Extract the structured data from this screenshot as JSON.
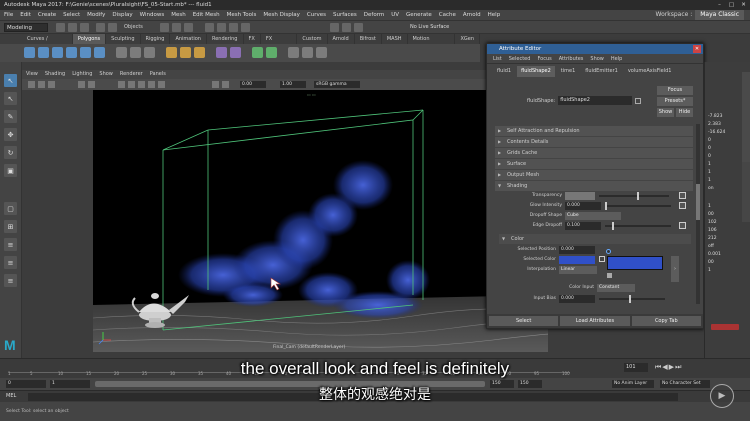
{
  "window": {
    "title": "Autodesk Maya 2017: F:\\Genie\\scenes\\Pluralsight\\FS_05-Start.mb* --- fluid1",
    "controls": [
      "–",
      "□",
      "✕"
    ]
  },
  "menubar": {
    "items": [
      "File",
      "Edit",
      "Create",
      "Select",
      "Modify",
      "Display",
      "Windows",
      "Mesh",
      "Edit Mesh",
      "Mesh Tools",
      "Mesh Display",
      "Curves",
      "Surfaces",
      "Deform",
      "UV",
      "Generate",
      "Cache",
      "Arnold",
      "Help"
    ],
    "workspace_label": "Workspace :",
    "workspace_value": "Maya Classic"
  },
  "statusline": {
    "mode": "Modeling",
    "objects_label": "Objects",
    "live_surface": "No Live Surface"
  },
  "shelf": {
    "tabs": [
      "Curves / Surfaces",
      "Polygons",
      "Sculpting",
      "Rigging",
      "Animation",
      "Rendering",
      "FX",
      "FX Caching",
      "Custom",
      "Arnold",
      "Bifrost",
      "MASH",
      "Motion Graphics",
      "XGen"
    ],
    "active_tab": "Polygons"
  },
  "panel": {
    "menu": [
      "View",
      "Shading",
      "Lighting",
      "Show",
      "Renderer",
      "Panels"
    ],
    "field_a": "0.00",
    "field_b": "1.00",
    "color_space": "sRGB gamma",
    "camera_label": "Final_Cam (defaultRenderLayer)"
  },
  "attribute_editor": {
    "title": "Attribute Editor",
    "menu": [
      "List",
      "Selected",
      "Focus",
      "Attributes",
      "Show",
      "Help"
    ],
    "tabs": [
      "fluid1",
      "fluidShape2",
      "time1",
      "fluidEmitter1",
      "volumeAxisField1"
    ],
    "active_tab": "fluidShape2",
    "node_label": "fluidShape:",
    "node_value": "fluidShape2",
    "buttons": {
      "focus": "Focus",
      "presets": "Presets*",
      "show": "Show",
      "hide": "Hide"
    },
    "sections": [
      {
        "label": "Self Attraction and Repulsion",
        "open": false
      },
      {
        "label": "Contents Details",
        "open": false
      },
      {
        "label": "Grids Cache",
        "open": false
      },
      {
        "label": "Surface",
        "open": false
      },
      {
        "label": "Output Mesh",
        "open": false
      },
      {
        "label": "Shading",
        "open": true
      }
    ],
    "shading": {
      "transparency_label": "Transparency",
      "glow_label": "Glow Intensity",
      "glow_value": "0.000",
      "dropoff_shape_label": "Dropoff Shape",
      "dropoff_shape_value": "Cube",
      "edge_dropoff_label": "Edge Dropoff",
      "edge_dropoff_value": "0.100"
    },
    "color_section": "Color",
    "color": {
      "selected_position_label": "Selected Position",
      "selected_position_value": "0.000",
      "selected_color_label": "Selected Color",
      "interpolation_label": "Interpolation",
      "interpolation_value": "Linear",
      "color_input_label": "Color Input",
      "color_input_value": "Constant",
      "input_bias_label": "Input Bias",
      "input_bias_value": "0.000",
      "ramp_color": "#3050c8"
    },
    "bottom_buttons": [
      "Select",
      "Load Attributes",
      "Copy Tab"
    ]
  },
  "channel_box": {
    "values_top": [
      "-7.823",
      "2.383",
      "-16.624",
      "0",
      "0",
      "0",
      "1",
      "1",
      "1",
      "on"
    ],
    "values_bottom": [
      "1",
      "00",
      "102",
      "106",
      "212",
      "off",
      "0.001",
      "00",
      "1"
    ]
  },
  "timeline": {
    "tick_labels": [
      "1",
      "5",
      "10",
      "15",
      "20",
      "25",
      "30",
      "35",
      "40",
      "45",
      "50",
      "55",
      "60",
      "65",
      "70",
      "75",
      "80",
      "85",
      "90",
      "95",
      "100"
    ],
    "current_frame": "101",
    "range_start": "0",
    "range_start2": "1",
    "range_end": "150",
    "range_end2": "150",
    "anim_layer": "No Anim Layer",
    "character_set": "No Character Set"
  },
  "command": {
    "mel_label": "MEL",
    "help_text": "Select Tool: select an object"
  },
  "subtitles": {
    "english": "the overall look and feel is definitely",
    "chinese": "整体的观感绝对是"
  },
  "colors": {
    "smoke": "#2a46b8",
    "bbox": "#4fc47a",
    "ae_title": "#2f5f95"
  }
}
